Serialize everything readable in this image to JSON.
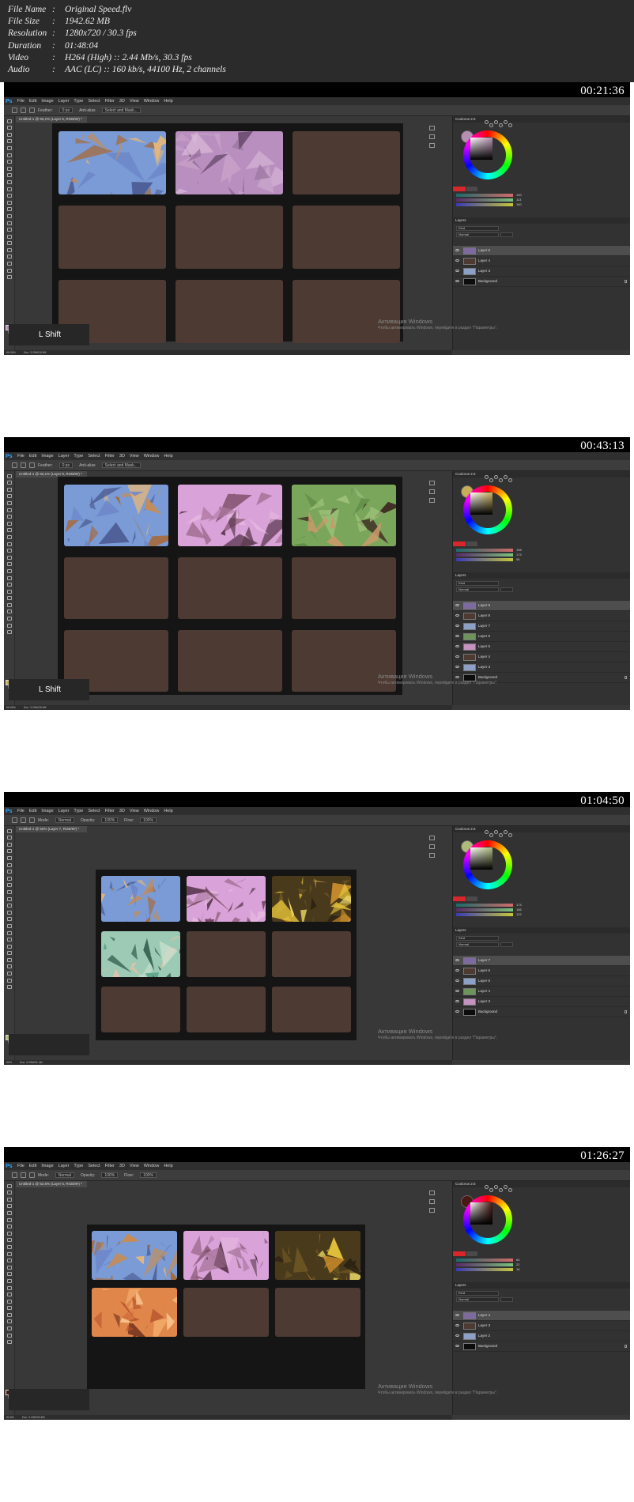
{
  "info": [
    {
      "key": "File Name",
      "value": "Original Speed.flv"
    },
    {
      "key": "File Size",
      "value": "1942.62 MB"
    },
    {
      "key": "Resolution",
      "value": "1280x720 / 30.3 fps"
    },
    {
      "key": "Duration",
      "value": "01:48:04"
    },
    {
      "key": "Video",
      "value": "H264 (High) :: 2.44 Mb/s, 30.3 fps"
    },
    {
      "key": "Audio",
      "value": "AAC (LC) :: 160 kb/s, 44100 Hz, 2 channels"
    }
  ],
  "menu": [
    "File",
    "Edit",
    "Image",
    "Layer",
    "Type",
    "Select",
    "Filter",
    "3D",
    "View",
    "Window",
    "Help"
  ],
  "watermark": {
    "title": "Активация Windows",
    "subtitle": "Чтобы активировать Windows, перейдите в раздел \"Параметры\"."
  },
  "panels": {
    "color_title": "Coolorus 2.5",
    "layers_title": "Layers",
    "blend_mode": "Normal",
    "kind": "Kind"
  },
  "frames": [
    {
      "timestamp": "00:21:36",
      "doc_tab": "Untitled-1 @ 66,1% (Layer 5, RGB/8#) *",
      "options": [
        "Feather:",
        "0 px",
        "Anti-alias",
        "Select and Mask..."
      ],
      "status": [
        "66.06%",
        "Doc: 3.29M/18.9M"
      ],
      "keycast": "L Shift",
      "fg_color": "#b98fb1",
      "layers": [
        "Layer 5",
        "Layer 4",
        "Layer 3",
        "Background"
      ],
      "selected_layer": 0,
      "slider_values": [
        "100",
        "113",
        "160"
      ]
    },
    {
      "timestamp": "00:43:13",
      "doc_tab": "Untitled-1 @ 66,1% (Layer 9, RGB/8#) *",
      "options": [
        "Feather:",
        "0 px",
        "Anti-alias",
        "Select and Mask..."
      ],
      "status": [
        "66.06%",
        "Doc: 3.29M/26.0M"
      ],
      "keycast": "L Shift",
      "fg_color": "#c9ae58",
      "layers": [
        "Layer 9",
        "Layer 8",
        "Layer 7",
        "Layer 6",
        "Layer 5",
        "Layer 4",
        "Layer 3",
        "Background"
      ],
      "selected_layer": 0,
      "slider_values": [
        "198",
        "174",
        "96"
      ]
    },
    {
      "timestamp": "01:04:50",
      "doc_tab": "Untitled-1 @ 50% (Layer 7, RGB/8#) *",
      "options": [
        "Mode:",
        "Normal",
        "Opacity:",
        "100%",
        "Flow:",
        "100%"
      ],
      "status": [
        "50%",
        "Doc: 3.29M/31.4M"
      ],
      "keycast": "",
      "fg_color": "#aebb7a",
      "layers": [
        "Layer 7",
        "Layer 6",
        "Layer 5",
        "Layer 4",
        "Layer 3",
        "Background"
      ],
      "selected_layer": 0,
      "slider_values": [
        "174",
        "186",
        "122"
      ]
    },
    {
      "timestamp": "01:26:27",
      "doc_tab": "Untitled-1 @ 52,6% (Layer 5, RGB/8#) *",
      "options": [
        "Mode:",
        "Normal",
        "Opacity:",
        "100%",
        "Flow:",
        "100%"
      ],
      "status": [
        "52.6%",
        "Doc: 3.29M/39.8M"
      ],
      "keycast": "",
      "fg_color": "#4a1a12",
      "layers": [
        "Layer 4",
        "Layer 3",
        "Layer 2",
        "Background"
      ],
      "selected_layer": 0,
      "slider_values": [
        "64",
        "22",
        "16"
      ]
    }
  ]
}
